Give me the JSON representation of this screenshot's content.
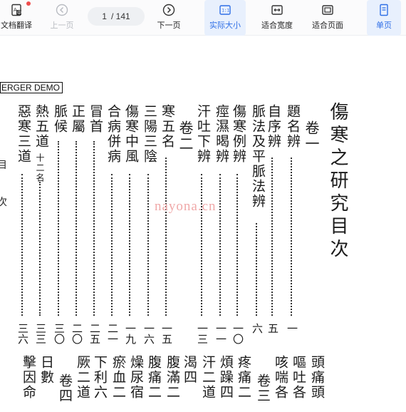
{
  "toolbar": {
    "translate_label": "文档翻译",
    "prev_label": "上一页",
    "page_current": "1",
    "page_total": "/ 141",
    "next_label": "下一页",
    "actual_size_label": "实际大小",
    "fit_width_label": "适合宽度",
    "fit_page_label": "适合页面",
    "single_page_label": "单页"
  },
  "document": {
    "demo_stamp": "ERGER DEMO",
    "watermark": "nayona.cn",
    "title": "傷寒之研究目次",
    "upper_columns": [
      {
        "text": "卷一",
        "page": ""
      },
      {
        "text": "題名辨",
        "page": "一"
      },
      {
        "text": "自序辨",
        "page": "五"
      },
      {
        "text": "脈法及平脈法辨",
        "page": "六"
      },
      {
        "text": "傷寒例辨",
        "page": "一〇"
      },
      {
        "text": "痙濕暍辨",
        "page": "一一"
      },
      {
        "text": "汗吐下辨",
        "page": "一三"
      },
      {
        "text": "卷二",
        "page": ""
      },
      {
        "text": "寒五名",
        "page": "一五"
      },
      {
        "text": "三陽三陰",
        "page": "一六"
      },
      {
        "text": "傷寒中風",
        "page": "一九"
      },
      {
        "text": "合病併病",
        "page": "二一"
      },
      {
        "text": "冒首",
        "page": "二五"
      },
      {
        "text": "正屬",
        "page": "二〇"
      },
      {
        "text": "脈候",
        "page": "三〇"
      },
      {
        "text": "熱五道",
        "note": "十二名",
        "page": "三三"
      },
      {
        "text": "惡寒三道",
        "page": "三六"
      }
    ],
    "lower_columns": [
      {
        "text": "頭痛頭"
      },
      {
        "text": "嘔吐各"
      },
      {
        "text": "咳喘各"
      },
      {
        "text": "卷三"
      },
      {
        "text": "疼痛二"
      },
      {
        "text": "煩躁四"
      },
      {
        "text": "汗二道"
      },
      {
        "text": "渴四"
      },
      {
        "text": "腹滿二"
      },
      {
        "text": "腹痛二"
      },
      {
        "text": "燥尿宿"
      },
      {
        "text": "瘀血二"
      },
      {
        "text": "下利六"
      },
      {
        "text": "厥二道"
      },
      {
        "text": "卷四"
      },
      {
        "text": "日數"
      },
      {
        "text": "擊因命"
      }
    ],
    "edge_chars": [
      "目",
      "次"
    ]
  }
}
